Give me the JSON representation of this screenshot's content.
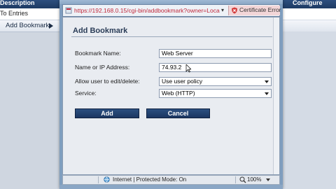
{
  "background": {
    "columns": [
      "Description",
      "Configure"
    ],
    "row1_text": "To Entries",
    "row2_text": "Add Bookmark"
  },
  "browser": {
    "url": "https://192.168.0.15/cgi-bin/addbookmark?owner=Loca",
    "cert_error": "Certificate Error",
    "status_text": "Internet | Protected Mode: On",
    "zoom": "100%"
  },
  "form": {
    "title": "Add Bookmark",
    "fields": [
      {
        "label": "Bookmark Name:",
        "value": "Web Server"
      },
      {
        "label": "Name or IP Address:",
        "value": "74.93.2"
      },
      {
        "label": "Allow user to edit/delete:",
        "value": "Use user policy"
      },
      {
        "label": "Service:",
        "value": "Web (HTTP)"
      }
    ],
    "add_label": "Add",
    "cancel_label": "Cancel"
  },
  "colors": {
    "accent": "#1d3a63",
    "cert_error_bg": "#f3d6d8",
    "url_color": "#c0283a"
  }
}
